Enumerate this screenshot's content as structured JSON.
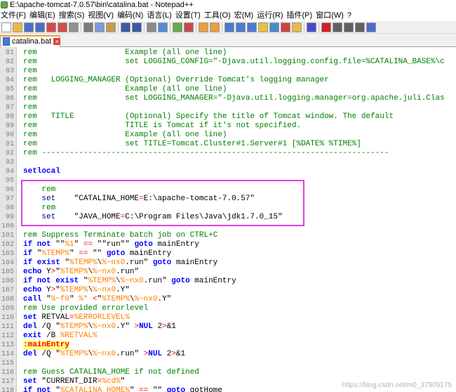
{
  "window": {
    "title": "E:\\apache-tomcat-7.0.57\\bin\\catalina.bat - Notepad++"
  },
  "menu": [
    "文件(F)",
    "编辑(E)",
    "搜索(S)",
    "视图(V)",
    "编码(N)",
    "语言(L)",
    "设置(T)",
    "工具(O)",
    "宏(M)",
    "运行(R)",
    "插件(P)",
    "窗口(W)",
    "?"
  ],
  "toolbar_icons": [
    {
      "name": "new-file-icon",
      "color": "#ffffff"
    },
    {
      "name": "open-file-icon",
      "color": "#e8b84a"
    },
    {
      "name": "save-icon",
      "color": "#4a6ec8"
    },
    {
      "name": "save-all-icon",
      "color": "#4a6ec8"
    },
    {
      "name": "close-icon",
      "color": "#d84a4a"
    },
    {
      "name": "close-all-icon",
      "color": "#d84a4a"
    },
    {
      "name": "print-icon",
      "color": "#909090"
    },
    {
      "name": "cut-icon",
      "color": "#7a7a7a"
    },
    {
      "name": "copy-icon",
      "color": "#7a9ad8"
    },
    {
      "name": "paste-icon",
      "color": "#c89a50"
    },
    {
      "name": "undo-icon",
      "color": "#3a5aa8"
    },
    {
      "name": "redo-icon",
      "color": "#3a5aa8"
    },
    {
      "name": "find-icon",
      "color": "#8a8a8a"
    },
    {
      "name": "replace-icon",
      "color": "#5a8ad8"
    },
    {
      "name": "zoom-in-icon",
      "color": "#6aa84f"
    },
    {
      "name": "zoom-out-icon",
      "color": "#c84a4a"
    },
    {
      "name": "sync-vertical-icon",
      "color": "#e8a040"
    },
    {
      "name": "sync-horizontal-icon",
      "color": "#e8a040"
    },
    {
      "name": "word-wrap-icon",
      "color": "#4a7ad0"
    },
    {
      "name": "show-all-chars-icon",
      "color": "#4a7ad0"
    },
    {
      "name": "indent-guide-icon",
      "color": "#4a7ad0"
    },
    {
      "name": "language-udl-icon",
      "color": "#e8c040"
    },
    {
      "name": "doc-map-icon",
      "color": "#4a8ad0"
    },
    {
      "name": "function-list-icon",
      "color": "#d04040"
    },
    {
      "name": "folder-workspace-icon",
      "color": "#e8b84a"
    },
    {
      "name": "monitoring-icon",
      "color": "#4a4ad0"
    },
    {
      "name": "record-macro-icon",
      "color": "#d02020"
    },
    {
      "name": "stop-macro-icon",
      "color": "#606060"
    },
    {
      "name": "play-macro-icon",
      "color": "#606060"
    },
    {
      "name": "play-multiple-macro-icon",
      "color": "#606060"
    },
    {
      "name": "save-macro-icon",
      "color": "#4a6ec8"
    }
  ],
  "tab": {
    "label": "catalina.bat"
  },
  "lines": [
    {
      "n": "81",
      "parts": [
        [
          "c",
          "rem                   Example (all one line)"
        ]
      ]
    },
    {
      "n": "82",
      "parts": [
        [
          "c",
          "rem                   set LOGGING_CONFIG=\"-Djava.util.logging.config.file=%CATALINA_BASE%\\c"
        ]
      ]
    },
    {
      "n": "83",
      "parts": [
        [
          "c",
          "rem"
        ]
      ]
    },
    {
      "n": "84",
      "parts": [
        [
          "c",
          "rem   LOGGING_MANAGER (Optional) Override Tomcat's logging manager"
        ]
      ]
    },
    {
      "n": "85",
      "parts": [
        [
          "c",
          "rem                   Example (all one line)"
        ]
      ]
    },
    {
      "n": "86",
      "parts": [
        [
          "c",
          "rem                   set LOGGING_MANAGER=\"-Djava.util.logging.manager=org.apache.juli.Clas"
        ]
      ]
    },
    {
      "n": "87",
      "parts": [
        [
          "c",
          "rem"
        ]
      ]
    },
    {
      "n": "88",
      "parts": [
        [
          "c",
          "rem   TITLE           (Optional) Specify the title of Tomcat window. The default"
        ]
      ]
    },
    {
      "n": "89",
      "parts": [
        [
          "c",
          "rem                   TITLE is Tomcat if it's not specified."
        ]
      ]
    },
    {
      "n": "90",
      "parts": [
        [
          "c",
          "rem                   Example (all one line)"
        ]
      ]
    },
    {
      "n": "91",
      "parts": [
        [
          "c",
          "rem                   set TITLE=Tomcat.Cluster#1.Server#1 [%DATE% %TIME%]"
        ]
      ]
    },
    {
      "n": "92",
      "parts": [
        [
          "c",
          "rem ---------------------------------------------------------------------------"
        ]
      ]
    },
    {
      "n": "93",
      "parts": []
    },
    {
      "n": "94",
      "parts": [
        [
          "kw",
          "setlocal"
        ]
      ]
    },
    {
      "n": "95",
      "parts": []
    },
    {
      "n": "96",
      "parts": [
        [
          "c",
          "    rem"
        ]
      ]
    },
    {
      "n": "97",
      "parts": [
        [
          "pl",
          "    "
        ],
        [
          "ar",
          "set"
        ],
        [
          "pl",
          "    \"CATALINA_HOME"
        ],
        [
          "op",
          "="
        ],
        [
          "pl",
          "E:\\apache-tomcat-7.0.57\""
        ]
      ]
    },
    {
      "n": "98",
      "parts": [
        [
          "c",
          "    rem"
        ]
      ]
    },
    {
      "n": "99",
      "parts": [
        [
          "pl",
          "    "
        ],
        [
          "ar",
          "set"
        ],
        [
          "pl",
          "    \"JAVA_HOME"
        ],
        [
          "op",
          "="
        ],
        [
          "pl",
          "C:\\Program Files\\Java\\jdk1.7.0_15\""
        ]
      ]
    },
    {
      "n": "100",
      "parts": []
    },
    {
      "n": "101",
      "parts": [
        [
          "c",
          "rem Suppress Terminate batch job on CTRL+C"
        ]
      ]
    },
    {
      "n": "102",
      "parts": [
        [
          "kw",
          "if not"
        ],
        [
          "pl",
          " \"\""
        ],
        [
          "vr",
          "%1"
        ],
        [
          "pl",
          "\" "
        ],
        [
          "op",
          "=="
        ],
        [
          "pl",
          " \"\"run\"\" "
        ],
        [
          "kw",
          "goto"
        ],
        [
          "pl",
          " mainEntry"
        ]
      ]
    },
    {
      "n": "103",
      "parts": [
        [
          "kw",
          "if"
        ],
        [
          "pl",
          " \""
        ],
        [
          "vr",
          "%TEMP%"
        ],
        [
          "pl",
          "\" "
        ],
        [
          "op",
          "=="
        ],
        [
          "pl",
          " \"\" "
        ],
        [
          "kw",
          "goto"
        ],
        [
          "pl",
          " mainEntry"
        ]
      ]
    },
    {
      "n": "104",
      "parts": [
        [
          "kw",
          "if exist"
        ],
        [
          "pl",
          " \""
        ],
        [
          "vr",
          "%TEMP%"
        ],
        [
          "pl",
          "\\"
        ],
        [
          "vr",
          "%~nx0"
        ],
        [
          "pl",
          ".run\" "
        ],
        [
          "kw",
          "goto"
        ],
        [
          "pl",
          " mainEntry"
        ]
      ]
    },
    {
      "n": "105",
      "parts": [
        [
          "kw",
          "echo"
        ],
        [
          "pl",
          " Y"
        ],
        [
          "op",
          ">"
        ],
        [
          "pl",
          "\""
        ],
        [
          "vr",
          "%TEMP%"
        ],
        [
          "pl",
          "\\"
        ],
        [
          "vr",
          "%~nx0"
        ],
        [
          "pl",
          ".run\""
        ]
      ]
    },
    {
      "n": "106",
      "parts": [
        [
          "kw",
          "if not exist"
        ],
        [
          "pl",
          " \""
        ],
        [
          "vr",
          "%TEMP%"
        ],
        [
          "pl",
          "\\"
        ],
        [
          "vr",
          "%~nx0"
        ],
        [
          "pl",
          ".run\" "
        ],
        [
          "kw",
          "goto"
        ],
        [
          "pl",
          " mainEntry"
        ]
      ]
    },
    {
      "n": "107",
      "parts": [
        [
          "kw",
          "echo"
        ],
        [
          "pl",
          " Y"
        ],
        [
          "op",
          ">"
        ],
        [
          "pl",
          "\""
        ],
        [
          "vr",
          "%TEMP%"
        ],
        [
          "pl",
          "\\"
        ],
        [
          "vr",
          "%~nx0"
        ],
        [
          "pl",
          ".Y\""
        ]
      ]
    },
    {
      "n": "108",
      "parts": [
        [
          "kw",
          "call"
        ],
        [
          "pl",
          " \""
        ],
        [
          "vr",
          "%~f0"
        ],
        [
          "pl",
          "\" "
        ],
        [
          "vr",
          "%*"
        ],
        [
          "pl",
          " "
        ],
        [
          "op",
          "<"
        ],
        [
          "pl",
          "\""
        ],
        [
          "vr",
          "%TEMP%"
        ],
        [
          "pl",
          "\\"
        ],
        [
          "vr",
          "%~nx0"
        ],
        [
          "pl",
          ".Y\""
        ]
      ]
    },
    {
      "n": "109",
      "parts": [
        [
          "c",
          "rem Use provided errorlevel"
        ]
      ]
    },
    {
      "n": "110",
      "parts": [
        [
          "kw",
          "set"
        ],
        [
          "pl",
          " RETVAL"
        ],
        [
          "op",
          "="
        ],
        [
          "vr",
          "%ERRORLEVEL%"
        ]
      ]
    },
    {
      "n": "111",
      "parts": [
        [
          "kw",
          "del"
        ],
        [
          "pl",
          " /Q \""
        ],
        [
          "vr",
          "%TEMP%"
        ],
        [
          "pl",
          "\\"
        ],
        [
          "vr",
          "%~nx0"
        ],
        [
          "pl",
          ".Y\" "
        ],
        [
          "op",
          ">"
        ],
        [
          "kw",
          "NUL"
        ],
        [
          "pl",
          " 2"
        ],
        [
          "op",
          ">"
        ],
        [
          "pl",
          "&1"
        ]
      ]
    },
    {
      "n": "112",
      "parts": [
        [
          "kw",
          "exit"
        ],
        [
          "pl",
          " /B "
        ],
        [
          "vr",
          "%RETVAL%"
        ]
      ]
    },
    {
      "n": "113",
      "label": true,
      "parts": [
        [
          "lb",
          ":mainEntry"
        ]
      ]
    },
    {
      "n": "114",
      "parts": [
        [
          "kw",
          "del"
        ],
        [
          "pl",
          " /Q \""
        ],
        [
          "vr",
          "%TEMP%"
        ],
        [
          "pl",
          "\\"
        ],
        [
          "vr",
          "%~nx0"
        ],
        [
          "pl",
          ".run\" "
        ],
        [
          "op",
          ">"
        ],
        [
          "kw",
          "NUL"
        ],
        [
          "pl",
          " 2"
        ],
        [
          "op",
          ">"
        ],
        [
          "pl",
          "&1"
        ]
      ]
    },
    {
      "n": "115",
      "parts": []
    },
    {
      "n": "116",
      "parts": [
        [
          "c",
          "rem Guess CATALINA_HOME if not defined"
        ]
      ]
    },
    {
      "n": "117",
      "parts": [
        [
          "kw",
          "set"
        ],
        [
          "pl",
          " \"CURRENT_DIR"
        ],
        [
          "op",
          "="
        ],
        [
          "vr",
          "%cd%"
        ],
        [
          "pl",
          "\""
        ]
      ]
    },
    {
      "n": "118",
      "parts": [
        [
          "kw",
          "if not"
        ],
        [
          "pl",
          " \""
        ],
        [
          "vr",
          "%CATALINA_HOME%"
        ],
        [
          "pl",
          "\" "
        ],
        [
          "op",
          "=="
        ],
        [
          "pl",
          " \"\" "
        ],
        [
          "kw",
          "goto"
        ],
        [
          "pl",
          " gotHome"
        ]
      ]
    }
  ],
  "watermark": "https://blog.csdn.net/m0_37905175"
}
